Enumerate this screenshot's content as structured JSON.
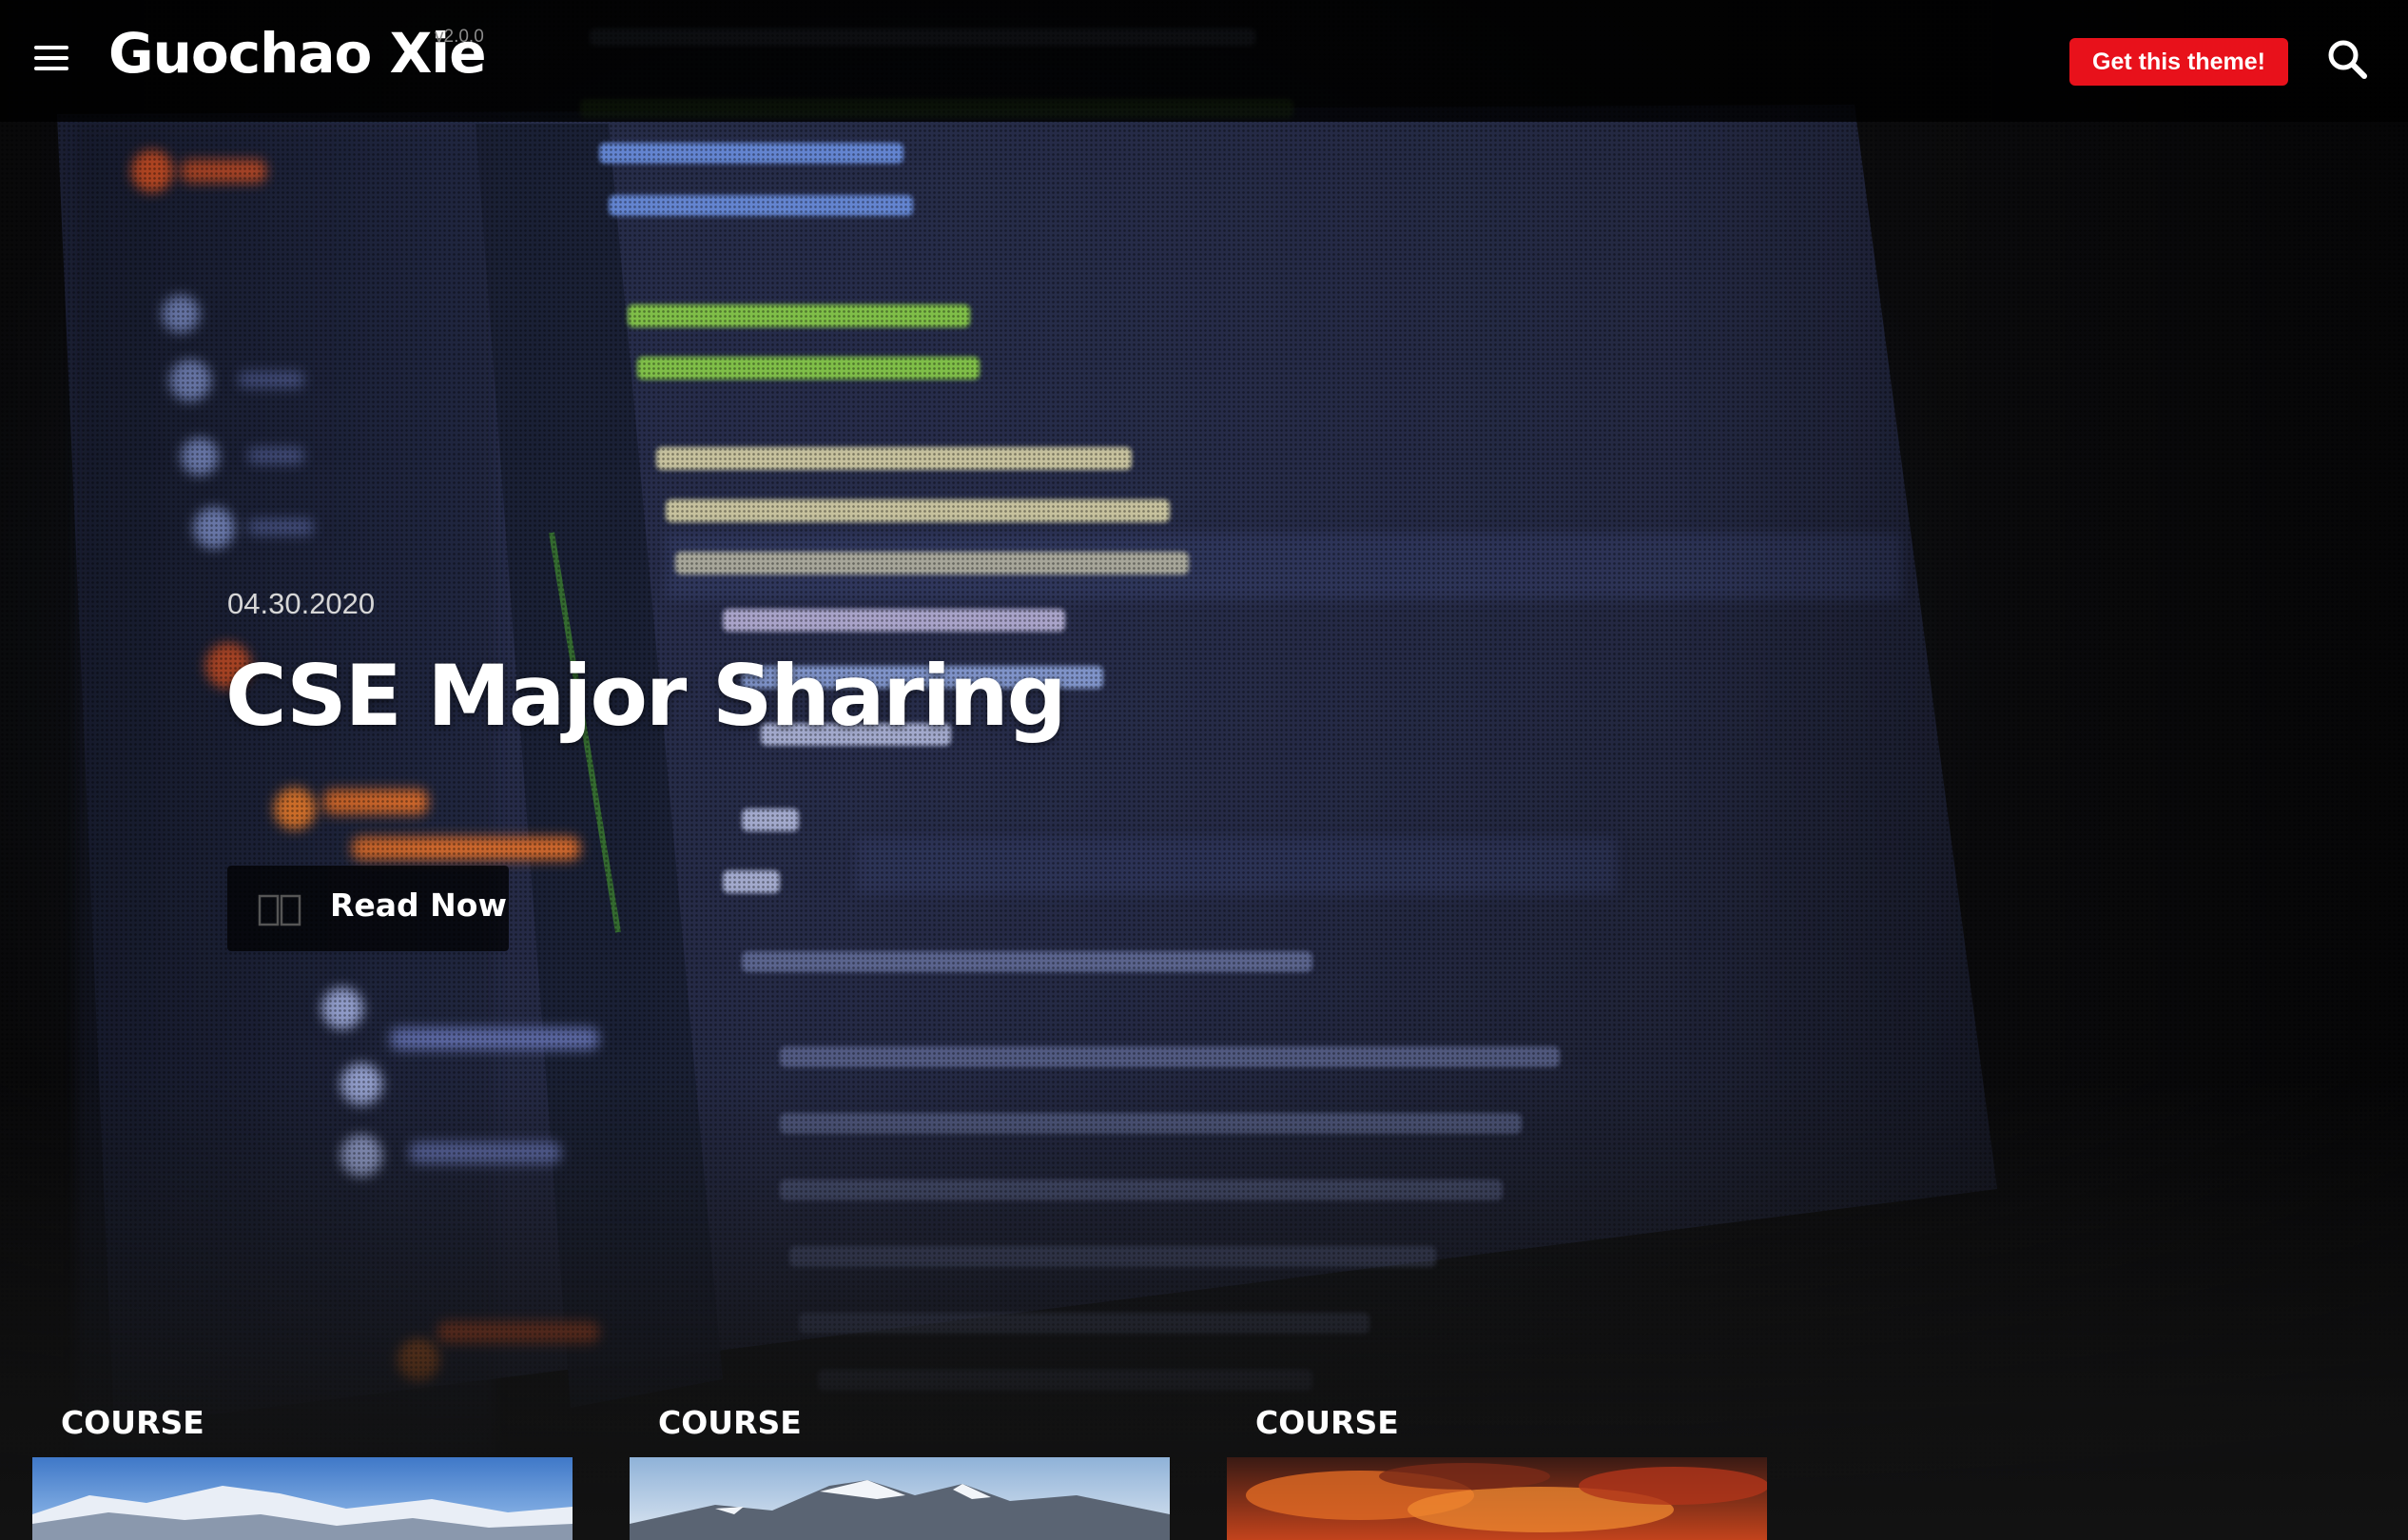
{
  "header": {
    "site_title": "Guochao Xie",
    "version": "v2.0.0",
    "cta_label": "Get this theme!",
    "icons": {
      "menu": "hamburger-menu-icon",
      "search": "search-icon"
    },
    "accent_color": "#e8111b"
  },
  "hero": {
    "date": "04.30.2020",
    "title": "CSE Major Sharing",
    "button_label": "Read Now",
    "button_icon": "open-book-icon"
  },
  "cards": [
    {
      "label": "COURSE",
      "image": "snowy-mountain-photo"
    },
    {
      "label": "COURSE",
      "image": "mountain-peaks-photo"
    },
    {
      "label": "COURSE",
      "image": "sunset-fire-clouds-photo"
    }
  ]
}
